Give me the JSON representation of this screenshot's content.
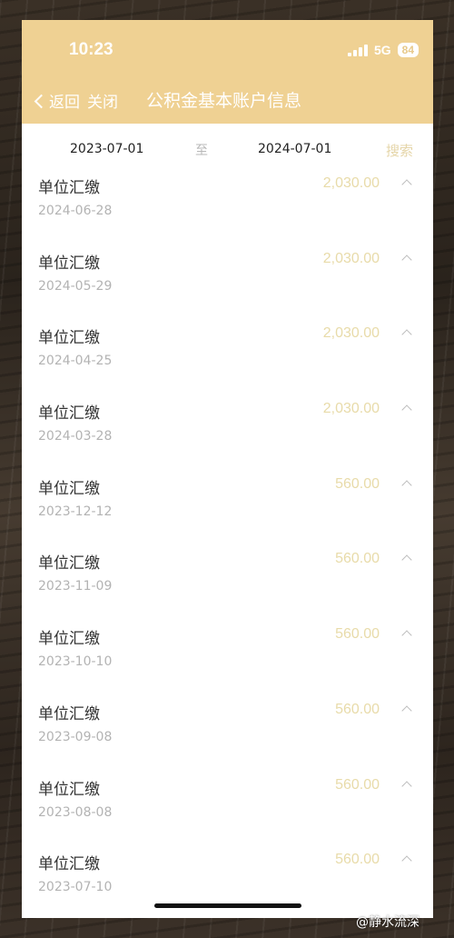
{
  "status_bar": {
    "time": "10:23",
    "network": "5G",
    "battery": "84"
  },
  "nav": {
    "back_label": "返回",
    "close_label": "关闭",
    "title": "公积金基本账户信息"
  },
  "filter": {
    "start_date": "2023-07-01",
    "separator": "至",
    "end_date": "2024-07-01",
    "search_label": "搜索"
  },
  "records": [
    {
      "title": "单位汇缴",
      "date": "2024-06-28",
      "amount": "2,030.00"
    },
    {
      "title": "单位汇缴",
      "date": "2024-05-29",
      "amount": "2,030.00"
    },
    {
      "title": "单位汇缴",
      "date": "2024-04-25",
      "amount": "2,030.00"
    },
    {
      "title": "单位汇缴",
      "date": "2024-03-28",
      "amount": "2,030.00"
    },
    {
      "title": "单位汇缴",
      "date": "2023-12-12",
      "amount": "560.00"
    },
    {
      "title": "单位汇缴",
      "date": "2023-11-09",
      "amount": "560.00"
    },
    {
      "title": "单位汇缴",
      "date": "2023-10-10",
      "amount": "560.00"
    },
    {
      "title": "单位汇缴",
      "date": "2023-09-08",
      "amount": "560.00"
    },
    {
      "title": "单位汇缴",
      "date": "2023-08-08",
      "amount": "560.00"
    },
    {
      "title": "单位汇缴",
      "date": "2023-07-10",
      "amount": "560.00"
    }
  ],
  "watermark": "@静水流深",
  "colors": {
    "header": "#efd193",
    "amount": "#e8dba9",
    "search": "#e5d5a8"
  }
}
